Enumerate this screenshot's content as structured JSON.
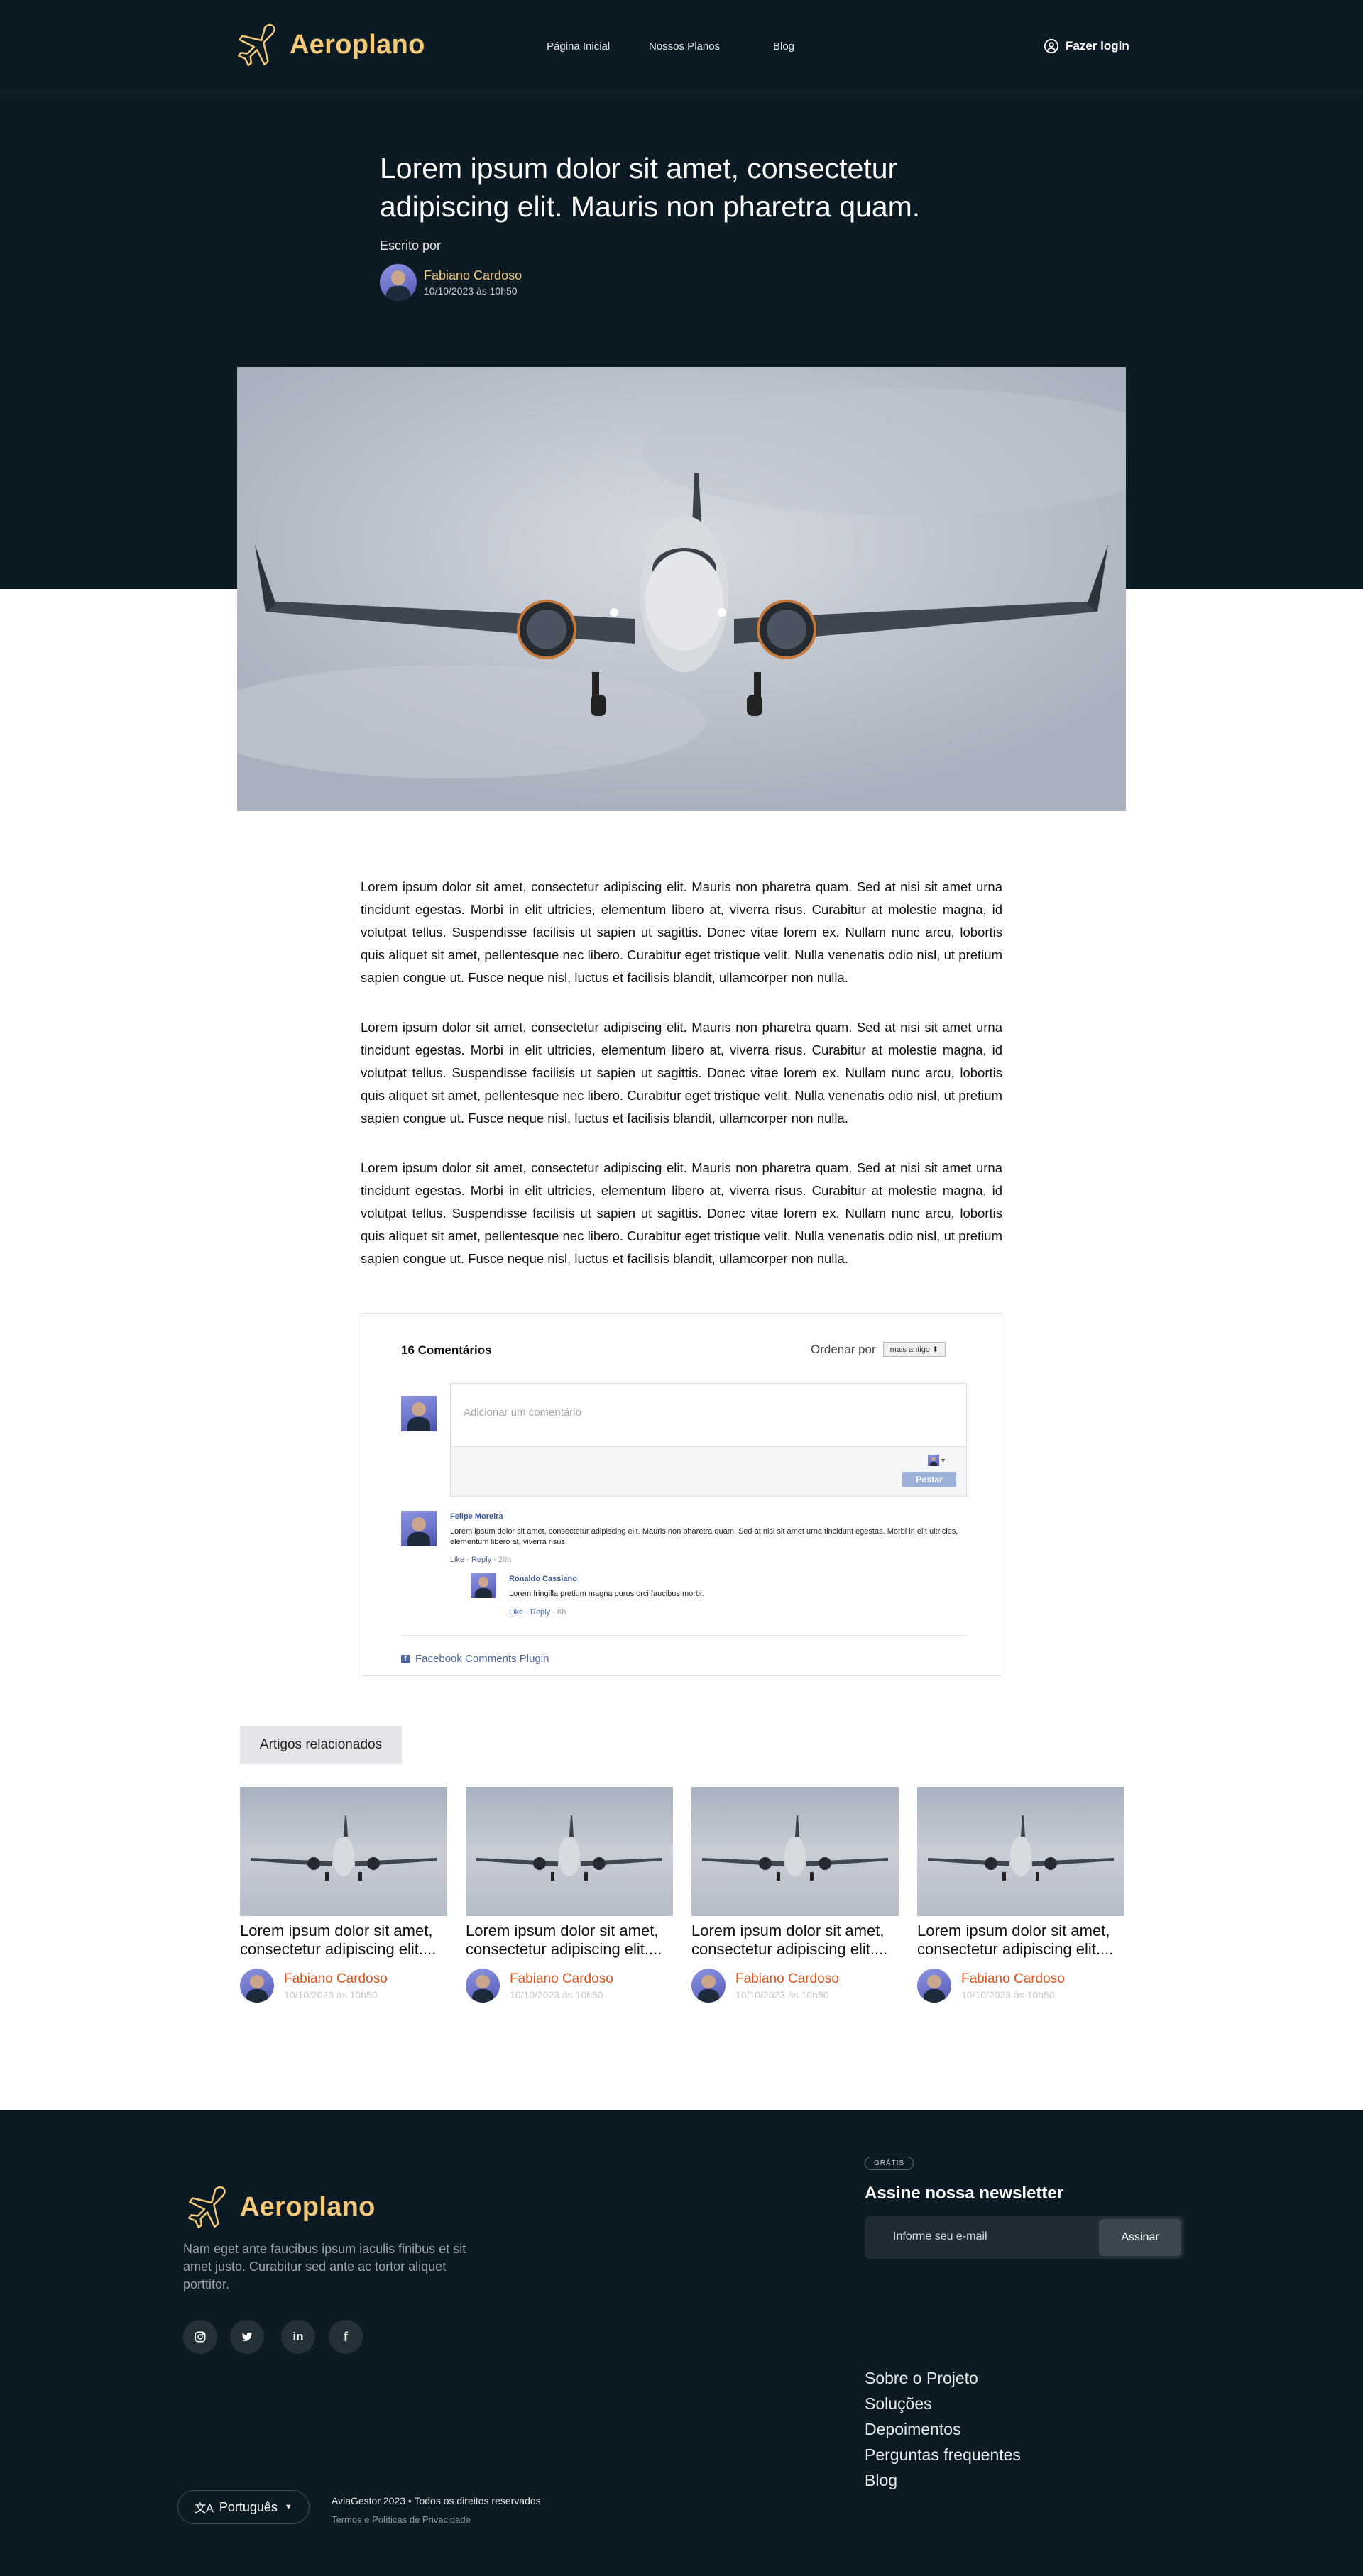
{
  "header": {
    "brand": "Aeroplano",
    "nav": [
      "Página Inicial",
      "Nossos Planos",
      "Blog"
    ],
    "login_label": "Fazer login"
  },
  "article": {
    "title": "Lorem ipsum dolor sit amet, consectetur adipiscing elit. Mauris non pharetra quam.",
    "written_by": "Escrito por",
    "author": "Fabiano Cardoso",
    "date": "10/10/2023 às 10h50",
    "paragraphs": [
      "Lorem ipsum dolor sit amet, consectetur adipiscing elit. Mauris non pharetra quam. Sed at nisi sit amet urna tincidunt egestas. Morbi in elit ultricies, elementum libero at, viverra risus. Curabitur at molestie magna, id volutpat tellus. Suspendisse facilisis ut sapien ut sagittis. Donec vitae lorem ex. Nullam nunc arcu, lobortis quis aliquet sit amet, pellentesque nec libero. Curabitur eget tristique velit. Nulla venenatis odio nisl, ut pretium sapien congue ut. Fusce neque nisl, luctus et facilisis blandit, ullamcorper non nulla.",
      "Lorem ipsum dolor sit amet, consectetur adipiscing elit. Mauris non pharetra quam. Sed at nisi sit amet urna tincidunt egestas. Morbi in elit ultricies, elementum libero at, viverra risus. Curabitur at molestie magna, id volutpat tellus. Suspendisse facilisis ut sapien ut sagittis. Donec vitae lorem ex. Nullam nunc arcu, lobortis quis aliquet sit amet, pellentesque nec libero. Curabitur eget tristique velit. Nulla venenatis odio nisl, ut pretium sapien congue ut. Fusce neque nisl, luctus et facilisis blandit, ullamcorper non nulla.",
      "Lorem ipsum dolor sit amet, consectetur adipiscing elit. Mauris non pharetra quam. Sed at nisi sit amet urna tincidunt egestas. Morbi in elit ultricies, elementum libero at, viverra risus. Curabitur at molestie magna, id volutpat tellus. Suspendisse facilisis ut sapien ut sagittis. Donec vitae lorem ex. Nullam nunc arcu, lobortis quis aliquet sit amet, pellentesque nec libero. Curabitur eget tristique velit. Nulla venenatis odio nisl, ut pretium sapien congue ut. Fusce neque nisl, luctus et facilisis blandit, ullamcorper non nulla."
    ]
  },
  "comments": {
    "count_label": "16 Comentários",
    "order_label": "Ordenar por",
    "order_value": "mais antigo",
    "placeholder": "Adicionar um comentário",
    "post_label": "Postar",
    "items": [
      {
        "name": "Felipe Moreira",
        "text": "Lorem ipsum dolor sit amet, consectetur adipiscing elit. Mauris non pharetra quam. Sed at nisi sit amet urna tincidunt egestas. Morbi in elit ultricies, elementum libero at, viverra risus.",
        "like": "Like",
        "reply": "Reply",
        "time": "20h"
      },
      {
        "name": "Ronaldo Cassiano",
        "text": "Lorem fringilla pretium magna purus orci faucibus morbi.",
        "like": "Like",
        "reply": "Reply",
        "time": "6h"
      }
    ],
    "plugin": "Facebook Comments Plugin"
  },
  "related": {
    "heading": "Artigos relacionados",
    "cards": [
      {
        "title": "Lorem ipsum dolor sit amet, consectetur adipiscing elit....",
        "author": "Fabiano Cardoso",
        "date": "10/10/2023 às 10h50"
      },
      {
        "title": "Lorem ipsum dolor sit amet, consectetur adipiscing elit....",
        "author": "Fabiano Cardoso",
        "date": "10/10/2023 às 10h50"
      },
      {
        "title": "Lorem ipsum dolor sit amet, consectetur adipiscing elit....",
        "author": "Fabiano Cardoso",
        "date": "10/10/2023 às 10h50"
      },
      {
        "title": "Lorem ipsum dolor sit amet, consectetur adipiscing elit....",
        "author": "Fabiano Cardoso",
        "date": "10/10/2023 às 10h50"
      }
    ]
  },
  "footer": {
    "brand": "Aeroplano",
    "description": "Nam eget ante faucibus ipsum iaculis finibus et sit amet justo. Curabitur sed ante ac tortor aliquet porttitor.",
    "social": [
      "instagram-icon",
      "twitter-icon",
      "linkedin-icon",
      "facebook-icon"
    ],
    "newsletter_badge": "GRÁTIS",
    "newsletter_title": "Assine nossa newsletter",
    "newsletter_placeholder": "Informe seu e-mail",
    "newsletter_button": "Assinar",
    "links": [
      "Sobre o Projeto",
      "Soluções",
      "Depoimentos",
      "Perguntas frequentes",
      "Blog"
    ],
    "language": "Português",
    "copyright": "AviaGestor  2023  •  Todos os direitos reservados",
    "terms": "Termos e Políticas de Privacidade"
  },
  "colors": {
    "dark_bg": "#0c1a23",
    "brand_gold": "#f3c97a",
    "author_orange": "#d9541e",
    "link_blue": "#4b67a1"
  }
}
